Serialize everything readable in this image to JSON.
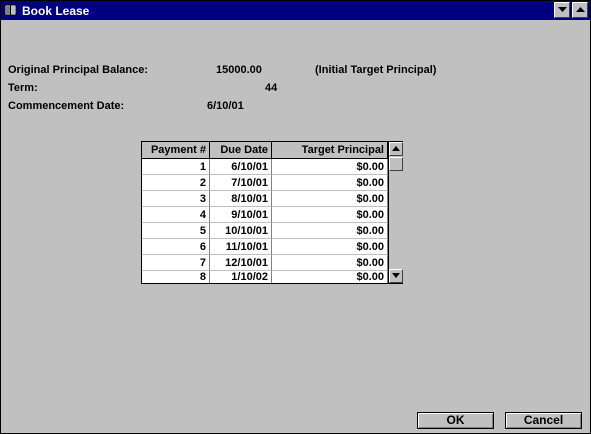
{
  "window": {
    "title": "Book Lease",
    "icon": "book-icon",
    "controls": [
      "minimize-icon",
      "maximize-icon"
    ]
  },
  "fields": {
    "original_principal_label": "Original Principal Balance:",
    "original_principal_value": "15000.00",
    "original_principal_note": "(Initial Target Principal)",
    "term_label": "Term:",
    "term_value": "44",
    "commencement_label": "Commencement Date:",
    "commencement_value": "6/10/01"
  },
  "grid": {
    "columns": [
      "Payment #",
      "Due Date",
      "Target Principal"
    ],
    "rows": [
      [
        "1",
        "6/10/01",
        "$0.00"
      ],
      [
        "2",
        "7/10/01",
        "$0.00"
      ],
      [
        "3",
        "8/10/01",
        "$0.00"
      ],
      [
        "4",
        "9/10/01",
        "$0.00"
      ],
      [
        "5",
        "10/10/01",
        "$0.00"
      ],
      [
        "6",
        "11/10/01",
        "$0.00"
      ],
      [
        "7",
        "12/10/01",
        "$0.00"
      ],
      [
        "8",
        "1/10/02",
        "$0.00"
      ]
    ]
  },
  "buttons": {
    "ok_label": "OK",
    "cancel_label": "Cancel"
  },
  "colors": {
    "titlebar": "#000080",
    "window_bg": "#c0c0c0",
    "grid_bg": "#ffffff"
  }
}
